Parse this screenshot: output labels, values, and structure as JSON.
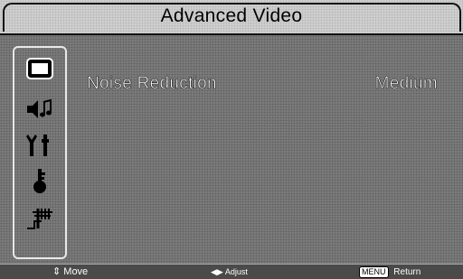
{
  "header": {
    "title": "Advanced Video"
  },
  "sidebar": {
    "icons": [
      {
        "name": "picture-icon",
        "selected": true
      },
      {
        "name": "audio-icon",
        "selected": false
      },
      {
        "name": "setup-tools-icon",
        "selected": false
      },
      {
        "name": "lock-key-icon",
        "selected": false
      },
      {
        "name": "antenna-channel-icon",
        "selected": false
      }
    ]
  },
  "menu": {
    "items": [
      {
        "label": "Noise Reduction",
        "value": "Medium"
      }
    ]
  },
  "footer": {
    "move_label": "Move",
    "adjust_label": "Adjust",
    "menu_key": "MENU",
    "return_label": "Return"
  }
}
